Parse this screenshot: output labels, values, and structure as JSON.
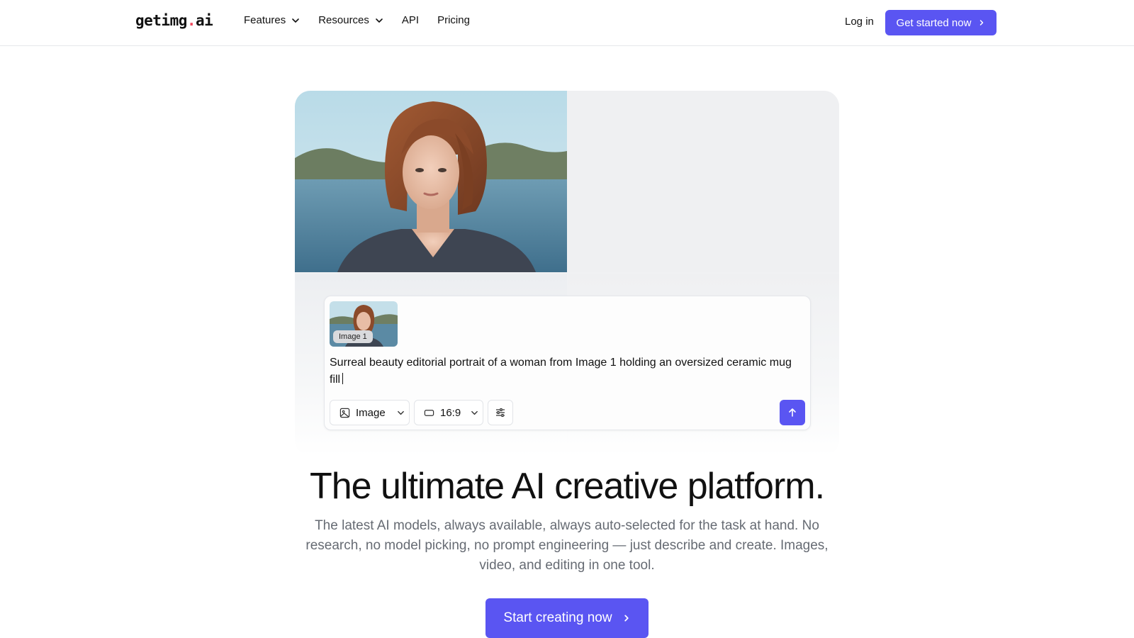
{
  "nav": {
    "logo_text": "getimg",
    "logo_dot": ".",
    "logo_suffix": "ai",
    "links": [
      {
        "label": "Features",
        "has_dropdown": true
      },
      {
        "label": "Resources",
        "has_dropdown": true
      },
      {
        "label": "API",
        "has_dropdown": false
      },
      {
        "label": "Pricing",
        "has_dropdown": false
      }
    ],
    "login_label": "Log in",
    "cta_label": "Get started now"
  },
  "composer": {
    "reference_badge": "Image 1",
    "prompt_text": "Surreal beauty editorial portrait of a woman from Image 1 holding an oversized ceramic mug fill",
    "mode_label": "Image",
    "ratio_label": "16:9"
  },
  "hero": {
    "headline": "The ultimate AI creative platform.",
    "subheadline": "The latest AI models, always available, always auto-selected for the task at hand. No research, no model picking, no prompt engineering — just describe and create. Images, video, and editing in one tool.",
    "cta_label": "Start creating now"
  },
  "colors": {
    "accent": "#5a55f2",
    "logo_dot": "#ef4a5e",
    "muted_text": "#666b73"
  }
}
